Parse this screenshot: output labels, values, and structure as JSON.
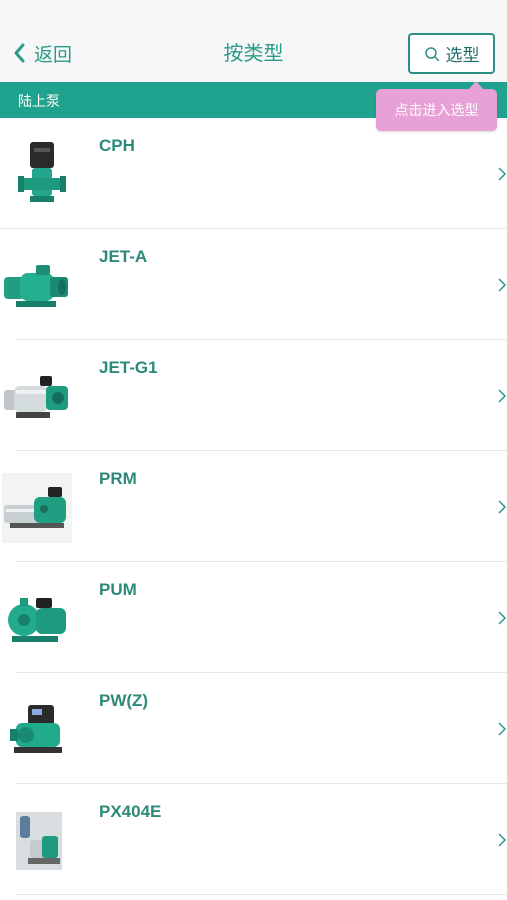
{
  "header": {
    "back_label": "返回",
    "title": "按类型",
    "select_label": "选型",
    "tooltip": "点击进入选型"
  },
  "section": {
    "label": "陆上泵"
  },
  "products": [
    {
      "name": "CPH",
      "icon": "vertical-circulator-pump"
    },
    {
      "name": "JET-A",
      "icon": "jet-pump"
    },
    {
      "name": "JET-G1",
      "icon": "jet-pump-stainless"
    },
    {
      "name": "PRM",
      "icon": "multistage-pump"
    },
    {
      "name": "PUM",
      "icon": "centrifugal-pump"
    },
    {
      "name": "PW(Z)",
      "icon": "booster-pump"
    },
    {
      "name": "PX404E",
      "icon": "pressure-tank-pump"
    }
  ],
  "colors": {
    "accent": "#2a9b8a",
    "section_bar": "#20a38e",
    "tooltip": "#e8a1d6"
  }
}
